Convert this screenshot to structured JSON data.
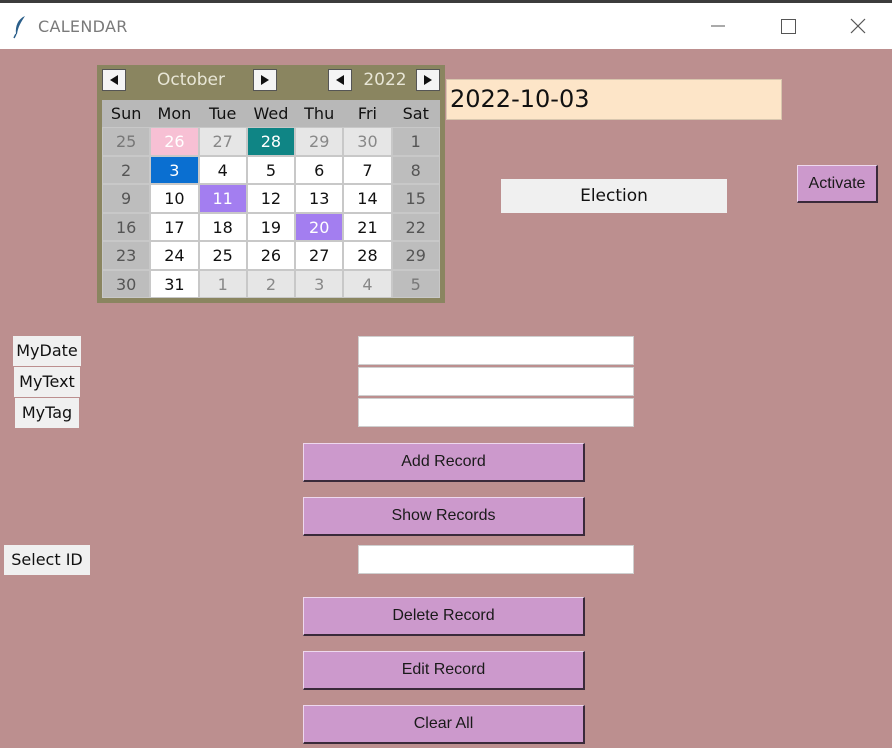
{
  "window": {
    "title": "CALENDAR",
    "icon": "feather-icon",
    "controls": [
      "minimize-icon",
      "maximize-icon",
      "close-icon"
    ]
  },
  "calendar": {
    "month": "October",
    "year": "2022",
    "weekdays": [
      "Sun",
      "Mon",
      "Tue",
      "Wed",
      "Thu",
      "Fri",
      "Sat"
    ],
    "weeks": [
      [
        "25",
        "26",
        "27",
        "28",
        "29",
        "30",
        "1"
      ],
      [
        "2",
        "3",
        "4",
        "5",
        "6",
        "7",
        "8"
      ],
      [
        "9",
        "10",
        "11",
        "12",
        "13",
        "14",
        "15"
      ],
      [
        "16",
        "17",
        "18",
        "19",
        "20",
        "21",
        "22"
      ],
      [
        "23",
        "24",
        "25",
        "26",
        "27",
        "28",
        "29"
      ],
      [
        "30",
        "31",
        "1",
        "2",
        "3",
        "4",
        "5"
      ]
    ],
    "selected_date": "3",
    "colors": {
      "header_bg": "#8a8560",
      "selected": "#0a6fd1",
      "event_purple": "#a37ef0",
      "event_teal": "#0f8585",
      "event_pink": "#f7c0d4"
    }
  },
  "date_display": "2022-10-03",
  "event_label": "Election",
  "buttons": {
    "activate": "Activate",
    "add_record": "Add Record",
    "show_records": "Show Records",
    "delete_record": "Delete Record",
    "edit_record": "Edit Record",
    "clear_all": "Clear All"
  },
  "labels": {
    "mydate": "MyDate",
    "mytext": "MyText",
    "mytag": "MyTag",
    "select_id": "Select ID"
  },
  "fields": {
    "mydate": "",
    "mytext": "",
    "mytag": "",
    "select_id": ""
  },
  "colors": {
    "background": "#bc8f8f",
    "button": "#cc99cc",
    "date_display_bg": "#fde5c8"
  }
}
